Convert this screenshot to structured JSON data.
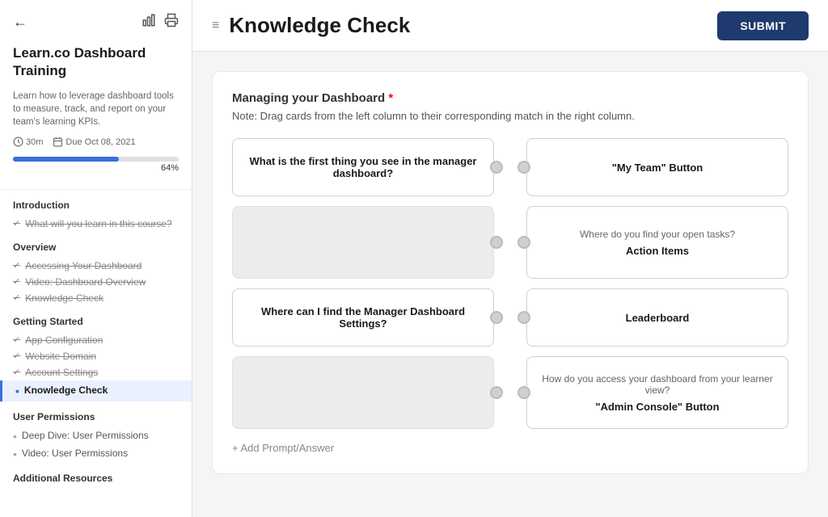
{
  "sidebar": {
    "back_label": "←",
    "icons": [
      "chart-icon",
      "print-icon"
    ],
    "title": "Learn.co Dashboard Training",
    "description": "Learn how to leverage dashboard tools to measure, track, and report on your team's learning KPIs.",
    "meta_time": "30m",
    "meta_due": "Due Oct 08, 2021",
    "progress_percent": 64,
    "progress_label": "64%",
    "sections": [
      {
        "title": "Introduction",
        "items": [
          {
            "label": "What will you learn in this course?",
            "state": "done",
            "active": false
          }
        ]
      },
      {
        "title": "Overview",
        "items": [
          {
            "label": "Accessing Your Dashboard",
            "state": "done",
            "active": false
          },
          {
            "label": "Video: Dashboard Overview",
            "state": "done",
            "active": false
          },
          {
            "label": "Knowledge Check",
            "state": "done",
            "active": false
          }
        ]
      },
      {
        "title": "Getting Started",
        "items": [
          {
            "label": "App Configuration",
            "state": "done",
            "active": false
          },
          {
            "label": "Website Domain",
            "state": "done",
            "active": false
          },
          {
            "label": "Account Settings",
            "state": "done",
            "active": false
          },
          {
            "label": "Knowledge Check",
            "state": "active",
            "active": true
          }
        ]
      },
      {
        "title": "User Permissions",
        "items": [
          {
            "label": "Deep Dive: User Permissions",
            "state": "bullet",
            "active": false
          },
          {
            "label": "Video: User Permissions",
            "state": "bullet",
            "active": false
          }
        ]
      },
      {
        "title": "Additional Resources",
        "items": []
      }
    ]
  },
  "header": {
    "breadcrumb_icon": "≡",
    "title": "Knowledge Check",
    "submit_label": "SUBMIT"
  },
  "content": {
    "section_title": "Managing your Dashboard",
    "note": "Note: Drag cards from the left column to their corresponding match in the right column.",
    "pairs": [
      {
        "left_text": "What is the first thing you see in the manager dashboard?",
        "left_empty": false,
        "right_text": "\"My Team\" Button",
        "right_empty": false
      },
      {
        "left_text": "",
        "left_empty": true,
        "right_text": "Action Items",
        "right_question": "Where do you find your open tasks?",
        "right_empty": false
      },
      {
        "left_text": "Where can I find the Manager Dashboard Settings?",
        "left_empty": false,
        "right_text": "Leaderboard",
        "right_empty": false
      },
      {
        "left_text": "",
        "left_empty": true,
        "right_text": "\"Admin Console\" Button",
        "right_question": "How do you access your dashboard from your learner view?",
        "right_empty": false
      }
    ],
    "add_prompt": "+ Add Prompt/Answer"
  }
}
